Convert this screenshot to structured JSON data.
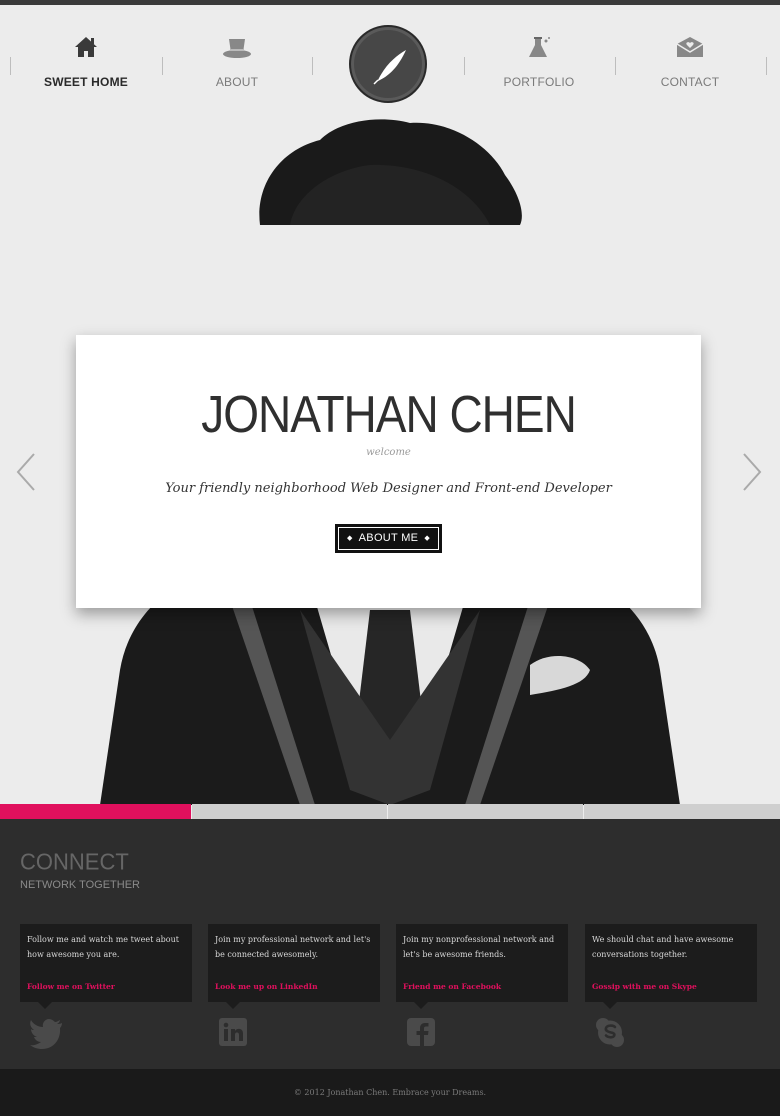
{
  "nav": {
    "items": [
      {
        "label": "SWEET HOME",
        "icon": "home-icon"
      },
      {
        "label": "ABOUT",
        "icon": "hat-icon"
      },
      {
        "label": "PORTFOLIO",
        "icon": "flask-icon"
      },
      {
        "label": "CONTACT",
        "icon": "envelope-icon"
      }
    ],
    "logo_icon": "quill-icon"
  },
  "hero": {
    "name": "JONATHAN CHEN",
    "welcome": "welcome",
    "tagline": "Your friendly neighborhood Web Designer and Front-end Developer",
    "button_label": "ABOUT ME",
    "slide_count": 4,
    "active_slide": 1
  },
  "connect": {
    "title": "CONNECT",
    "subtitle": "NETWORK TOGETHER",
    "cards": [
      {
        "text": "Follow me and watch me tweet about how awesome you are.",
        "link": "Follow me on Twitter",
        "icon": "twitter-icon"
      },
      {
        "text": "Join my professional network and let's be connected awesomely.",
        "link": "Look me up on LinkedIn",
        "icon": "linkedin-icon"
      },
      {
        "text": "Join my nonprofessional network and let's be awesome friends.",
        "link": "Friend me on Facebook",
        "icon": "facebook-icon"
      },
      {
        "text": "We should chat and have awesome conversations together.",
        "link": "Gossip with me on Skype",
        "icon": "skype-icon"
      }
    ]
  },
  "footer": {
    "copyright": "© 2012 Jonathan Chen. Embrace your Dreams."
  },
  "colors": {
    "accent": "#e0105d",
    "dark": "#2d2d2d"
  }
}
